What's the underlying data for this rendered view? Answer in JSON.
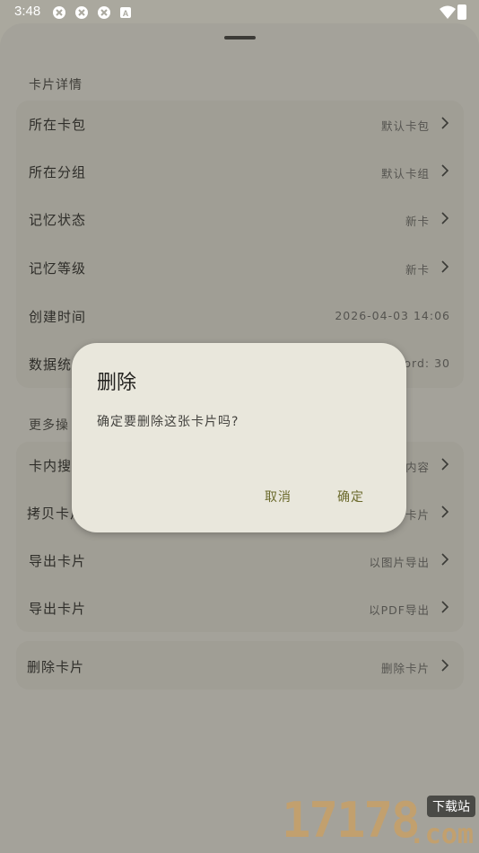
{
  "status": {
    "time": "3:48"
  },
  "sections": {
    "details_title": "卡片详情",
    "more_title": "更多操"
  },
  "details": [
    {
      "label": "所在卡包",
      "value": "默认卡包"
    },
    {
      "label": "所在分组",
      "value": "默认卡组"
    },
    {
      "label": "记忆状态",
      "value": "新卡"
    },
    {
      "label": "记忆等级",
      "value": "新卡"
    },
    {
      "label": "创建时间",
      "value": "2026-04-03 14:06"
    },
    {
      "label": "数据统",
      "value": "ord: 30"
    }
  ],
  "more": [
    {
      "label": "卡内搜",
      "value": "内容"
    },
    {
      "label": "拷贝卡片",
      "value": "卡片"
    },
    {
      "label": "导出卡片",
      "value": "以图片导出"
    },
    {
      "label": "导出卡片",
      "value": "以PDF导出"
    }
  ],
  "delete_row": {
    "label": "删除卡片",
    "value": "删除卡片"
  },
  "dialog": {
    "title": "删除",
    "message": "确定要删除这张卡片吗?",
    "cancel": "取消",
    "confirm": "确定"
  },
  "watermark": {
    "digits": "17178",
    "badge": "下载站",
    "domain": ".com"
  }
}
